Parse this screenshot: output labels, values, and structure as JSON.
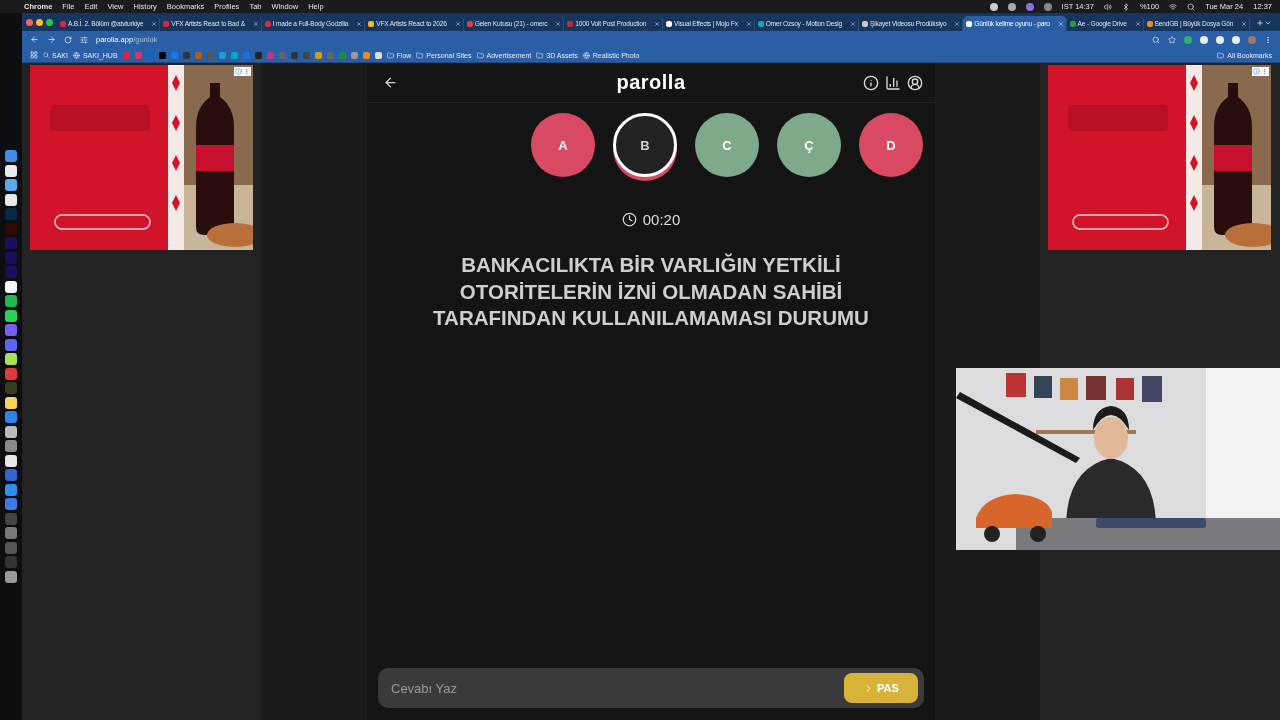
{
  "menu_bar": {
    "app": "Chrome",
    "menus": [
      "File",
      "Edit",
      "View",
      "History",
      "Bookmarks",
      "Profiles",
      "Tab",
      "Window",
      "Help"
    ],
    "time_zone": "IST 14:37",
    "battery": "%100",
    "date": "Tue Mar 24",
    "clock": "12:37"
  },
  "tabs": [
    {
      "title": "A.B.İ. 2. Bölüm @atvturkiye",
      "color": "#e0243a",
      "selected": false
    },
    {
      "title": "VFX Artists React to Bad &",
      "color": "#e0243a",
      "selected": false
    },
    {
      "title": "I made a Full-Body Godzilla",
      "color": "#e0243a",
      "selected": false
    },
    {
      "title": "VFX Artists React to 2026",
      "color": "#e8c21a",
      "selected": false
    },
    {
      "title": "Gelen Kutusu (21) - omerc",
      "color": "#d44638",
      "selected": false
    },
    {
      "title": "1000 Volt Post Production",
      "color": "#c8283c",
      "selected": false
    },
    {
      "title": "Visual Effects | Mojo Fx",
      "color": "#ffffff",
      "selected": false
    },
    {
      "title": "Omer Ozsoy - Motion Desig",
      "color": "#16a3b8",
      "selected": false
    },
    {
      "title": "Şikayet Videosu Prodüksiyo",
      "color": "#c9c9c9",
      "selected": false
    },
    {
      "title": "Günlük kelime oyunu - paro",
      "color": "#ffffff",
      "selected": true
    },
    {
      "title": "Ae - Google Drive",
      "color": "#2d9c4a",
      "selected": false
    },
    {
      "title": "SendGB | Büyük Dosya Gön",
      "color": "#f08a1c",
      "selected": false
    }
  ],
  "address_bar": {
    "host": "parolla.app",
    "path": "/gunluk"
  },
  "bookmarks": {
    "before": [
      {
        "label": "SAKI",
        "kind": "search"
      },
      {
        "label": "SAKI_HUB",
        "kind": "site"
      }
    ],
    "after": [
      {
        "label": "Flow",
        "kind": "folder"
      },
      {
        "label": "Personal Sites",
        "kind": "folder"
      },
      {
        "label": "Advertisement",
        "kind": "folder"
      },
      {
        "label": "3D Assets",
        "kind": "folder"
      },
      {
        "label": "Realistic Photo",
        "kind": "site"
      }
    ],
    "all": "All Bookmarks"
  },
  "game": {
    "title": "parolla",
    "letters": [
      {
        "letter": "A",
        "kind": "wrong"
      },
      {
        "letter": "B",
        "kind": "current"
      },
      {
        "letter": "C",
        "kind": "correct"
      },
      {
        "letter": "Ç",
        "kind": "correct"
      },
      {
        "letter": "D",
        "kind": "wrong"
      }
    ],
    "timer": "00:20",
    "question": "BANKACILIKTA BİR VARLIĞIN YETKİLİ OTORİTELERİN İZNİ OLMADAN SAHİBİ TARAFINDAN KULLANILAMAMASI DURUMU",
    "answer": {
      "placeholder": "Cevabı Yaz"
    },
    "pass_button": "PAS"
  }
}
